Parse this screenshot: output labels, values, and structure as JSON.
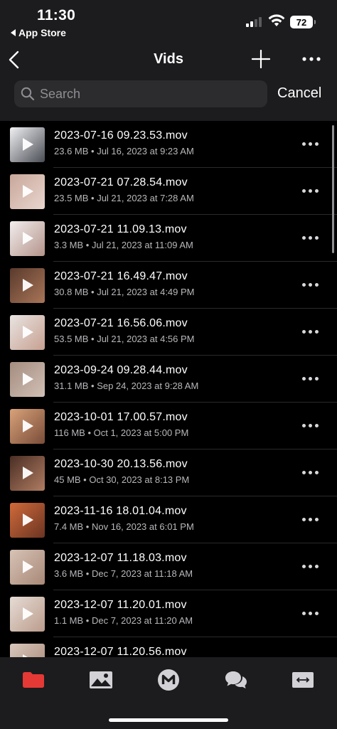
{
  "status_bar": {
    "time": "11:30",
    "back_app": "App Store",
    "battery": "72"
  },
  "nav": {
    "title": "Vids"
  },
  "search": {
    "placeholder": "Search",
    "cancel_label": "Cancel"
  },
  "files": [
    {
      "name": "2023-07-16 09.23.53.mov",
      "meta": "23.6 MB • Jul 16, 2023 at 9:23 AM",
      "thumb_colors": [
        "#f1f1f3",
        "#4a4d55"
      ]
    },
    {
      "name": "2023-07-21 07.28.54.mov",
      "meta": "23.5 MB • Jul 21, 2023 at 7:28 AM",
      "thumb_colors": [
        "#c9a79a",
        "#e8d6cf"
      ]
    },
    {
      "name": "2023-07-21 11.09.13.mov",
      "meta": "3.3 MB • Jul 21, 2023 at 11:09 AM",
      "thumb_colors": [
        "#f2eeee",
        "#b4938a"
      ]
    },
    {
      "name": "2023-07-21 16.49.47.mov",
      "meta": "30.8 MB • Jul 21, 2023 at 4:49 PM",
      "thumb_colors": [
        "#5a3a2c",
        "#a87558"
      ]
    },
    {
      "name": "2023-07-21 16.56.06.mov",
      "meta": "53.5 MB • Jul 21, 2023 at 4:56 PM",
      "thumb_colors": [
        "#e9e4e2",
        "#c6a090"
      ]
    },
    {
      "name": "2023-09-24 09.28.44.mov",
      "meta": "31.1 MB • Sep 24, 2023 at 9:28 AM",
      "thumb_colors": [
        "#a48c80",
        "#d2c0b5"
      ]
    },
    {
      "name": "2023-10-01 17.00.57.mov",
      "meta": "116 MB • Oct 1, 2023 at 5:00 PM",
      "thumb_colors": [
        "#d8a27a",
        "#7a4c38"
      ]
    },
    {
      "name": "2023-10-30 20.13.56.mov",
      "meta": "45 MB • Oct 30, 2023 at 8:13 PM",
      "thumb_colors": [
        "#4a2e24",
        "#b07c62"
      ]
    },
    {
      "name": "2023-11-16 18.01.04.mov",
      "meta": "7.4 MB • Nov 16, 2023 at 6:01 PM",
      "thumb_colors": [
        "#d06a3a",
        "#6b3422"
      ]
    },
    {
      "name": "2023-12-07 11.18.03.mov",
      "meta": "3.6 MB • Dec 7, 2023 at 11:18 AM",
      "thumb_colors": [
        "#d7c3b6",
        "#a88877"
      ]
    },
    {
      "name": "2023-12-07 11.20.01.mov",
      "meta": "1.1 MB • Dec 7, 2023 at 11:20 AM",
      "thumb_colors": [
        "#e6dcd5",
        "#bb9c8c"
      ]
    },
    {
      "name": "2023-12-07 11.20.56.mov",
      "meta": "",
      "thumb_colors": [
        "#d9c7bc",
        "#a58676"
      ]
    }
  ],
  "tabs": [
    {
      "icon": "folder-icon",
      "color": "#e53935"
    },
    {
      "icon": "photos-icon",
      "color": "#d1d1d6"
    },
    {
      "icon": "m-logo-icon",
      "color": "#d1d1d6"
    },
    {
      "icon": "chat-icon",
      "color": "#d1d1d6"
    },
    {
      "icon": "transfer-icon",
      "color": "#d1d1d6"
    }
  ]
}
